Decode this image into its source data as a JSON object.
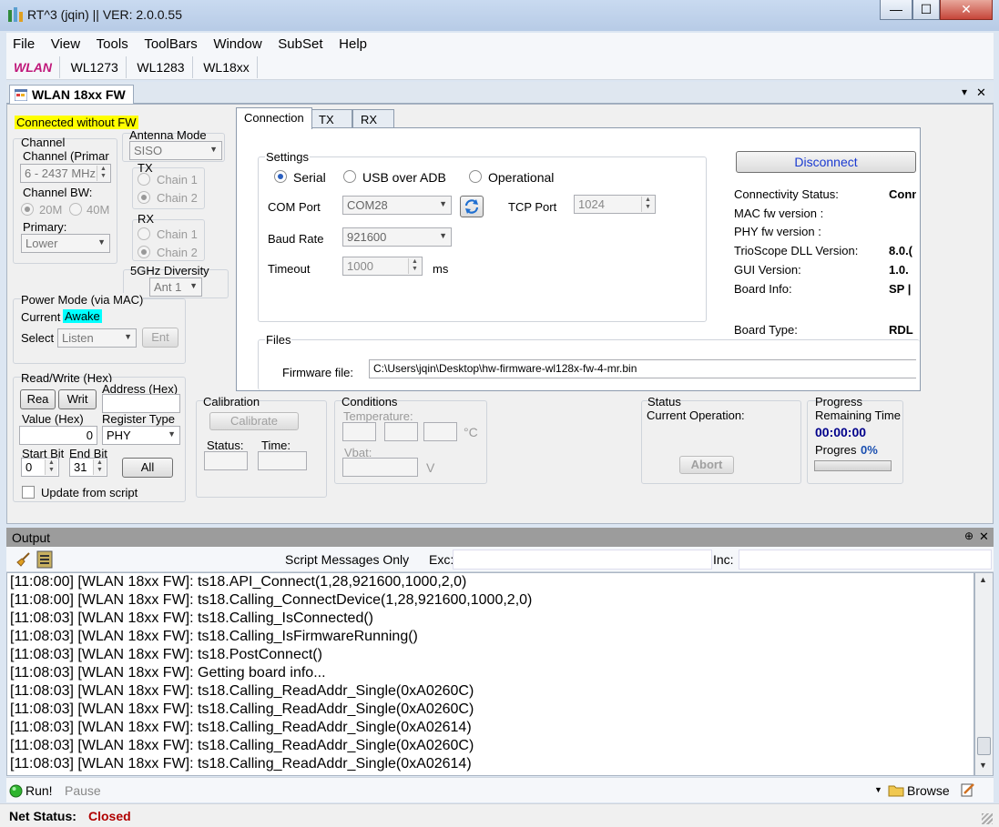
{
  "window": {
    "title": "RT^3 (jqin) || VER: 2.0.0.55",
    "minimize": "—",
    "maximize": "☐",
    "close": "✕"
  },
  "menu": [
    "File",
    "View",
    "Tools",
    "ToolBars",
    "Window",
    "SubSet",
    "Help"
  ],
  "subset_bar": [
    "WLAN",
    "WL1273",
    "WL1283",
    "WL18xx"
  ],
  "doc_tab": {
    "title": "WLAN 18xx FW",
    "dropdown": "▾",
    "close": "✕"
  },
  "left": {
    "connection_state": "Connected without FW",
    "channel": {
      "group": "Channel",
      "channel_label": "Channel (Primar",
      "channel_value": "6  - 2437 MHz",
      "bw_label": "Channel BW:",
      "bw_20": "20M",
      "bw_40": "40M",
      "primary_label": "Primary:",
      "primary_value": "Lower"
    },
    "antenna": {
      "group": "Antenna Mode",
      "mode_value": "SISO",
      "tx_label": "TX",
      "tx_chain1": "Chain 1",
      "tx_chain2": "Chain 2",
      "rx_label": "RX",
      "rx_chain1": "Chain 1",
      "rx_chain2": "Chain 2",
      "diversity_label": "5GHz Diversity",
      "diversity_value": "Ant 1"
    },
    "power": {
      "group": "Power Mode (via MAC)",
      "current_label": "Current",
      "current_value": "Awake",
      "select_label": "Select",
      "select_value": "Listen",
      "enter_button": "Ent"
    },
    "readwrite": {
      "group": "Read/Write (Hex)",
      "read_button": "Rea",
      "write_button": "Writ",
      "address_label": "Address (Hex)",
      "value_label": "Value (Hex)",
      "value_value": "0",
      "register_type_label": "Register Type",
      "register_type_value": "PHY",
      "start_bit_label": "Start Bit",
      "end_bit_label": "End Bit",
      "start_bit_value": "0",
      "end_bit_value": "31",
      "all_button": "All",
      "update_script_label": "Update from script"
    }
  },
  "tabs": [
    "Connection",
    "TX",
    "RX"
  ],
  "connection": {
    "settings_group": "Settings",
    "serial": "Serial",
    "usb_adb": "USB over ADB",
    "operational": "Operational",
    "com_port_label": "COM Port",
    "com_port_value": "COM28",
    "tcp_port_label": "TCP Port",
    "tcp_port_value": "1024",
    "baud_label": "Baud Rate",
    "baud_value": "921600",
    "timeout_label": "Timeout",
    "timeout_value": "1000",
    "timeout_unit": "ms",
    "disconnect_button": "Disconnect",
    "info": [
      {
        "label": "Connectivity Status:",
        "value": "Conn"
      },
      {
        "label": "MAC fw version :",
        "value": ""
      },
      {
        "label": "PHY fw version :",
        "value": ""
      },
      {
        "label": "TrioScope DLL Version:",
        "value": "8.0.("
      },
      {
        "label": "GUI Version:",
        "value": "1.0."
      },
      {
        "label": "Board Info:",
        "value": "SP |"
      }
    ],
    "board_type_label": "Board Type:",
    "board_type_value": "RDL",
    "files_group": "Files",
    "firmware_label": "Firmware file:",
    "firmware_value": "C:\\Users\\jqin\\Desktop\\hw-firmware-wl128x-fw-4-mr.bin"
  },
  "calibration": {
    "group": "Calibration",
    "button": "Calibrate",
    "status_label": "Status:",
    "time_label": "Time:"
  },
  "conditions": {
    "group": "Conditions",
    "temperature_label": "Temperature:",
    "temp_unit": "°C",
    "vbat_label": "Vbat:",
    "vbat_unit": "V"
  },
  "status": {
    "group": "Status",
    "current_op_label": "Current Operation:",
    "abort_button": "Abort"
  },
  "progress": {
    "group": "Progress",
    "remaining_label": "Remaining Time",
    "remaining_value": "00:00:00",
    "progress_label": "Progres",
    "progress_value": "0%",
    "fraction": 0
  },
  "output": {
    "title": "Output",
    "pin": "⊕",
    "close": "✕",
    "script_only": "Script Messages Only",
    "exc_label": "Exc:",
    "inc_label": "Inc:",
    "lines": [
      "[11:08:00]  [WLAN 18xx FW]: ts18.API_Connect(1,28,921600,1000,2,0)",
      "[11:08:00]  [WLAN 18xx FW]: ts18.Calling_ConnectDevice(1,28,921600,1000,2,0)",
      "[11:08:03]  [WLAN 18xx FW]: ts18.Calling_IsConnected()",
      "[11:08:03]  [WLAN 18xx FW]: ts18.Calling_IsFirmwareRunning()",
      "[11:08:03]  [WLAN 18xx FW]: ts18.PostConnect()",
      "[11:08:03]  [WLAN 18xx FW]: Getting board info...",
      "[11:08:03]  [WLAN 18xx FW]: ts18.Calling_ReadAddr_Single(0xA0260C)",
      "[11:08:03]  [WLAN 18xx FW]: ts18.Calling_ReadAddr_Single(0xA0260C)",
      "[11:08:03]  [WLAN 18xx FW]: ts18.Calling_ReadAddr_Single(0xA02614)",
      "[11:08:03]  [WLAN 18xx FW]: ts18.Calling_ReadAddr_Single(0xA0260C)",
      "[11:08:03]  [WLAN 18xx FW]: ts18.Calling_ReadAddr_Single(0xA02614)"
    ],
    "run_button": "Run!",
    "pause_button": "Pause",
    "browse_button": "Browse"
  },
  "net_status": {
    "label": "Net Status:",
    "value": "Closed"
  },
  "colors": {
    "highlight_yellow": "#ffff00",
    "highlight_cyan": "#00ffff",
    "wlan_magenta": "#c0187a",
    "closed_red": "#b00000",
    "time_blue": "#00008b"
  }
}
